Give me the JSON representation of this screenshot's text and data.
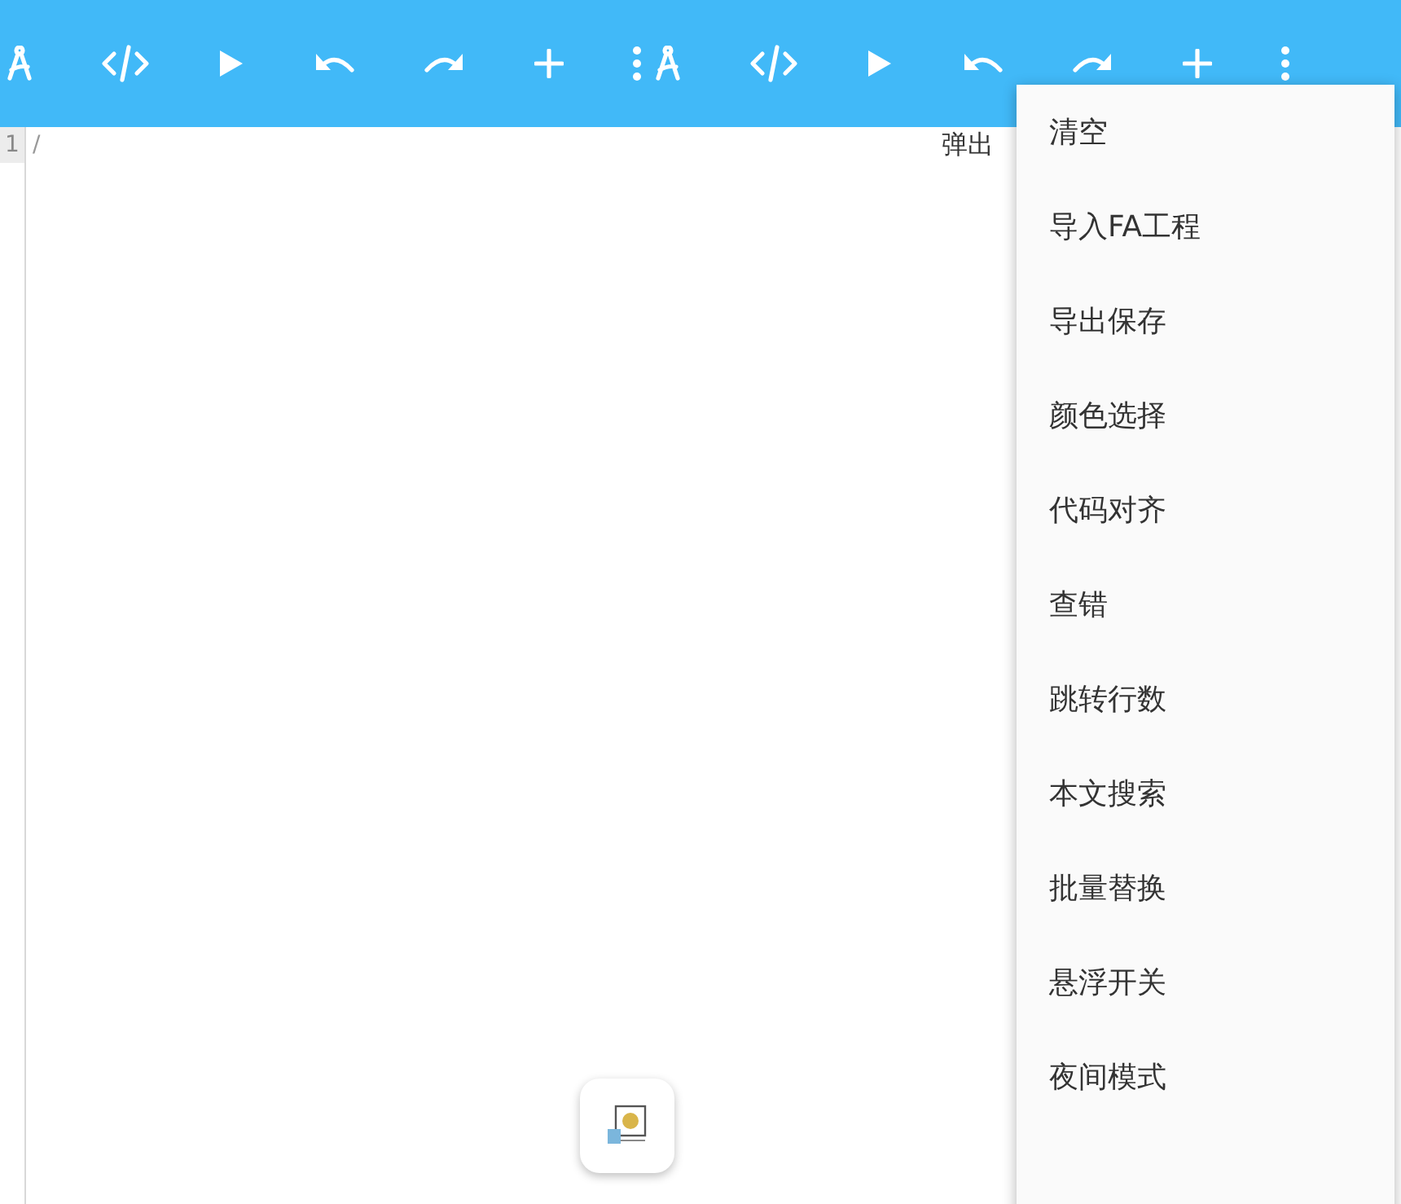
{
  "toolbar": {
    "items": [
      {
        "kind": "compass"
      },
      {
        "kind": "code"
      },
      {
        "kind": "play"
      },
      {
        "kind": "undo"
      },
      {
        "kind": "redo"
      },
      {
        "kind": "add"
      },
      {
        "kind": "more"
      },
      {
        "kind": "compass"
      },
      {
        "kind": "code"
      },
      {
        "kind": "play"
      },
      {
        "kind": "undo"
      },
      {
        "kind": "redo"
      },
      {
        "kind": "add"
      },
      {
        "kind": "more"
      }
    ]
  },
  "editor": {
    "line_numbers": [
      "1"
    ],
    "line_text": "/",
    "overlay_text": "弹出"
  },
  "menu": {
    "items": [
      {
        "label": "清空"
      },
      {
        "label": "导入FA工程"
      },
      {
        "label": "导出保存"
      },
      {
        "label": "颜色选择"
      },
      {
        "label": "代码对齐"
      },
      {
        "label": "查错"
      },
      {
        "label": "跳转行数"
      },
      {
        "label": "本文搜索"
      },
      {
        "label": "批量替换"
      },
      {
        "label": "悬浮开关"
      },
      {
        "label": "夜间模式"
      }
    ]
  },
  "floating_button": {
    "kind": "app-icon"
  }
}
